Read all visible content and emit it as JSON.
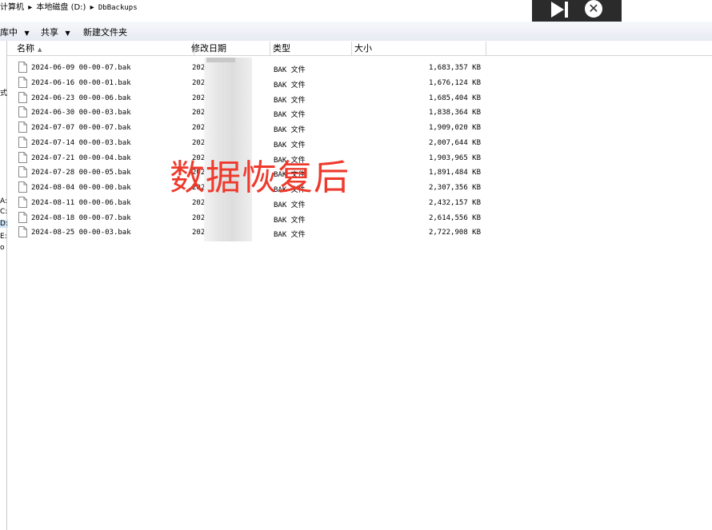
{
  "address": {
    "segments": [
      "计算机",
      "本地磁盘 (D:)",
      "DbBackups"
    ]
  },
  "toolbar": {
    "include_library_label": "库中",
    "share_label": "共享",
    "new_folder_label": "新建文件夹"
  },
  "left_pane": {
    "fragments": [
      "式",
      "A:",
      "C:",
      "D:",
      "E:",
      "o"
    ]
  },
  "columns": {
    "name": "名称",
    "modified": "修改日期",
    "type": "类型",
    "size": "大小"
  },
  "files": [
    {
      "name": "2024-06-09 00-00-07.bak",
      "date": "202",
      "type": "BAK 文件",
      "size": "1,683,357 KB"
    },
    {
      "name": "2024-06-16 00-00-01.bak",
      "date": "202",
      "type": "BAK 文件",
      "size": "1,676,124 KB"
    },
    {
      "name": "2024-06-23 00-00-06.bak",
      "date": "202",
      "type": "BAK 文件",
      "size": "1,685,404 KB"
    },
    {
      "name": "2024-06-30 00-00-03.bak",
      "date": "202",
      "type": "BAK 文件",
      "size": "1,838,364 KB"
    },
    {
      "name": "2024-07-07 00-00-07.bak",
      "date": "202",
      "type": "BAK 文件",
      "size": "1,909,020 KB"
    },
    {
      "name": "2024-07-14 00-00-03.bak",
      "date": "202",
      "type": "BAK 文件",
      "size": "2,007,644 KB"
    },
    {
      "name": "2024-07-21 00-00-04.bak",
      "date": "202",
      "type": "BAK 文件",
      "size": "1,903,965 KB"
    },
    {
      "name": "2024-07-28 00-00-05.bak",
      "date": "202",
      "type": "BAK 文件",
      "size": "1,891,484 KB"
    },
    {
      "name": "2024-08-04 00-00-00.bak",
      "date": "202",
      "type": "BAK 文件",
      "size": "2,307,356 KB"
    },
    {
      "name": "2024-08-11 00-00-06.bak",
      "date": "202",
      "type": "BAK 文件",
      "size": "2,432,157 KB"
    },
    {
      "name": "2024-08-18 00-00-07.bak",
      "date": "202",
      "type": "BAK 文件",
      "size": "2,614,556 KB"
    },
    {
      "name": "2024-08-25 00-00-03.bak",
      "date": "202",
      "type": "BAK 文件",
      "size": "2,722,908 KB"
    }
  ],
  "watermark": "数据恢复后",
  "overlay": {
    "play_icon": "play-icon",
    "close_icon": "close-icon"
  },
  "colors": {
    "watermark": "#ee3a2c",
    "overlay_bg": "#2b2b2b"
  }
}
